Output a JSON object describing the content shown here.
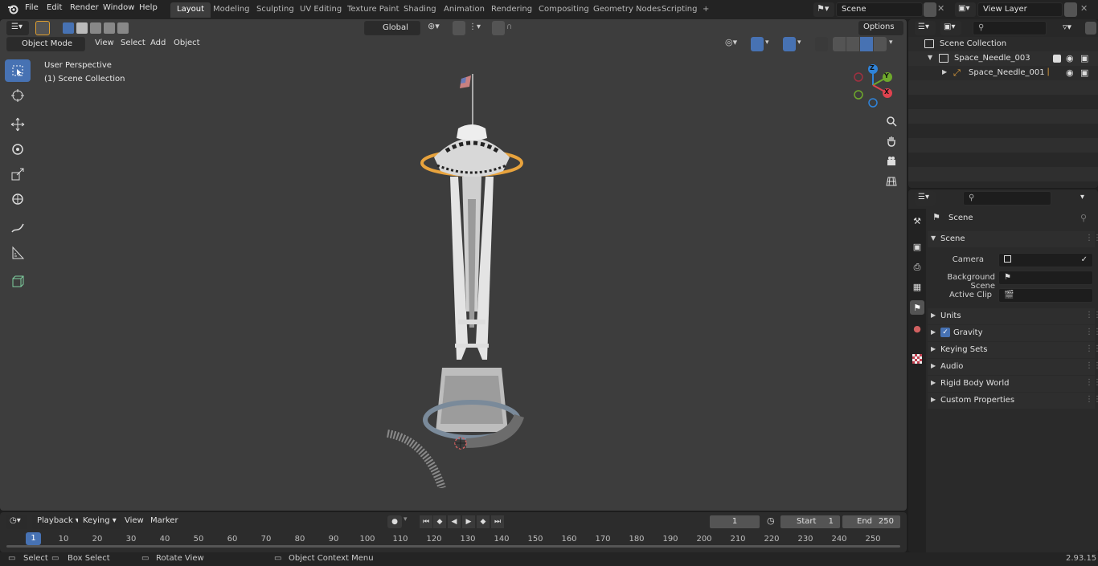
{
  "topbar": {
    "menus": [
      "File",
      "Edit",
      "Render",
      "Window",
      "Help"
    ],
    "workspaces": [
      "Layout",
      "Modeling",
      "Sculpting",
      "UV Editing",
      "Texture Paint",
      "Shading",
      "Animation",
      "Rendering",
      "Compositing",
      "Geometry Nodes",
      "Scripting"
    ],
    "add_tab": "+",
    "scene_name": "Scene",
    "view_layer": "View Layer"
  },
  "viewport": {
    "mode": "Object Mode",
    "menus": [
      "View",
      "Select",
      "Add",
      "Object"
    ],
    "orientation": "Global",
    "options": "Options",
    "info_line1": "User Perspective",
    "info_line2": "(1) Scene Collection",
    "gizmo_axes": [
      "Z",
      "Y",
      "X"
    ]
  },
  "outliner": {
    "search_placeholder": "",
    "collection": "Scene Collection",
    "items": [
      "Space_Needle_003",
      "Space_Needle_001"
    ]
  },
  "properties": {
    "context": "Scene",
    "section": "Scene",
    "fields": [
      {
        "label": "Camera",
        "value": ""
      },
      {
        "label": "Background Scene",
        "value": ""
      },
      {
        "label": "Active Clip",
        "value": ""
      }
    ],
    "panels": [
      "Units",
      "Gravity",
      "Keying Sets",
      "Audio",
      "Rigid Body World",
      "Custom Properties"
    ],
    "gravity_checked": true
  },
  "timeline": {
    "menus": [
      "Playback",
      "Keying",
      "View",
      "Marker"
    ],
    "current_frame": "1",
    "start_label": "Start",
    "start": "1",
    "end_label": "End",
    "end": "250",
    "ruler_current": "1",
    "ruler_ticks": [
      "10",
      "20",
      "30",
      "40",
      "50",
      "60",
      "70",
      "80",
      "90",
      "100",
      "110",
      "120",
      "130",
      "140",
      "150",
      "160",
      "170",
      "180",
      "190",
      "200",
      "210",
      "220",
      "230",
      "240",
      "250"
    ]
  },
  "statusbar": {
    "select": "Select",
    "box_select": "Box Select",
    "rotate": "Rotate View",
    "context_menu": "Object Context Menu",
    "version": "2.93.15"
  },
  "colors": {
    "accent": "#4772b3",
    "active_outline": "#e8a33d",
    "axis_x": "#e0424f",
    "axis_y": "#6ea82c",
    "axis_z": "#2f83d9"
  }
}
